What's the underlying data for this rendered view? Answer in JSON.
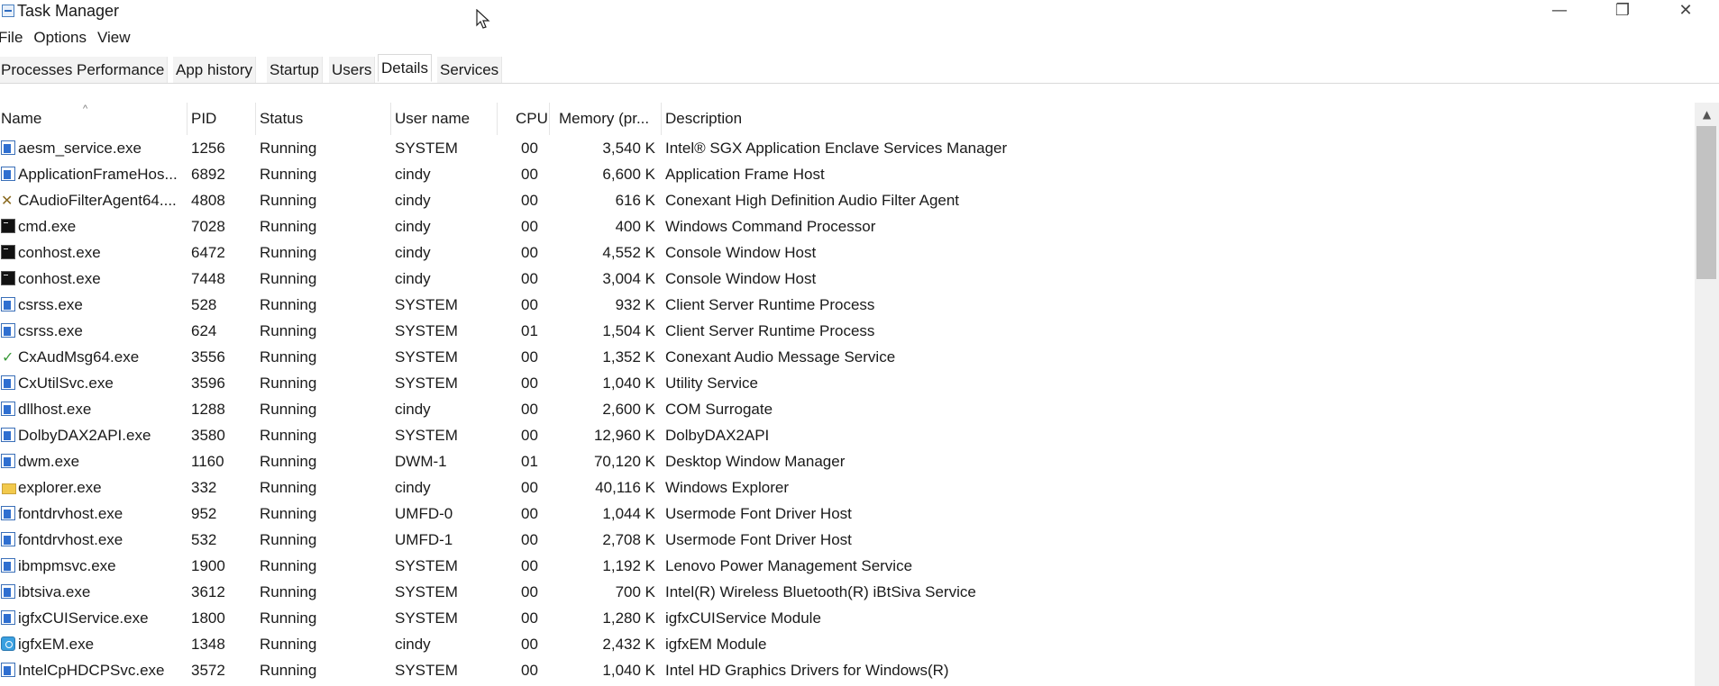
{
  "window": {
    "title": "Task Manager",
    "minimize_glyph": "—",
    "restore_glyph": "❐",
    "close_glyph": "✕"
  },
  "menu": [
    "File",
    "Options",
    "View"
  ],
  "tabs": [
    {
      "label": "Processes",
      "active": false
    },
    {
      "label": "Performance",
      "active": false
    },
    {
      "label": "App history",
      "active": false
    },
    {
      "label": "Startup",
      "active": false
    },
    {
      "label": "Users",
      "active": false
    },
    {
      "label": "Details",
      "active": true
    },
    {
      "label": "Services",
      "active": false
    }
  ],
  "table": {
    "columns": {
      "name": "Name",
      "pid": "PID",
      "status": "Status",
      "user": "User name",
      "cpu": "CPU",
      "memory": "Memory (pr...",
      "description": "Description"
    },
    "sort_glyph": "^",
    "rows": [
      {
        "icon": "app-icon",
        "name": "aesm_service.exe",
        "pid": "1256",
        "status": "Running",
        "user": "SYSTEM",
        "cpu": "00",
        "memory": "3,540 K",
        "description": "Intel® SGX Application Enclave Services Manager"
      },
      {
        "icon": "app-icon",
        "name": "ApplicationFrameHos...",
        "pid": "6892",
        "status": "Running",
        "user": "cindy",
        "cpu": "00",
        "memory": "6,600 K",
        "description": "Application Frame Host"
      },
      {
        "icon": "tools-icon",
        "name": "CAudioFilterAgent64....",
        "pid": "4808",
        "status": "Running",
        "user": "cindy",
        "cpu": "00",
        "memory": "616 K",
        "description": "Conexant High Definition Audio Filter Agent"
      },
      {
        "icon": "console-icon",
        "name": "cmd.exe",
        "pid": "7028",
        "status": "Running",
        "user": "cindy",
        "cpu": "00",
        "memory": "400 K",
        "description": "Windows Command Processor"
      },
      {
        "icon": "console-icon",
        "name": "conhost.exe",
        "pid": "6472",
        "status": "Running",
        "user": "cindy",
        "cpu": "00",
        "memory": "4,552 K",
        "description": "Console Window Host"
      },
      {
        "icon": "console-icon",
        "name": "conhost.exe",
        "pid": "7448",
        "status": "Running",
        "user": "cindy",
        "cpu": "00",
        "memory": "3,004 K",
        "description": "Console Window Host"
      },
      {
        "icon": "app-icon",
        "name": "csrss.exe",
        "pid": "528",
        "status": "Running",
        "user": "SYSTEM",
        "cpu": "00",
        "memory": "932 K",
        "description": "Client Server Runtime Process"
      },
      {
        "icon": "app-icon",
        "name": "csrss.exe",
        "pid": "624",
        "status": "Running",
        "user": "SYSTEM",
        "cpu": "01",
        "memory": "1,504 K",
        "description": "Client Server Runtime Process"
      },
      {
        "icon": "check-icon",
        "name": "CxAudMsg64.exe",
        "pid": "3556",
        "status": "Running",
        "user": "SYSTEM",
        "cpu": "00",
        "memory": "1,352 K",
        "description": "Conexant Audio Message Service"
      },
      {
        "icon": "app-icon",
        "name": "CxUtilSvc.exe",
        "pid": "3596",
        "status": "Running",
        "user": "SYSTEM",
        "cpu": "00",
        "memory": "1,040 K",
        "description": "Utility Service"
      },
      {
        "icon": "app-icon",
        "name": "dllhost.exe",
        "pid": "1288",
        "status": "Running",
        "user": "cindy",
        "cpu": "00",
        "memory": "2,600 K",
        "description": "COM Surrogate"
      },
      {
        "icon": "app-icon",
        "name": "DolbyDAX2API.exe",
        "pid": "3580",
        "status": "Running",
        "user": "SYSTEM",
        "cpu": "00",
        "memory": "12,960 K",
        "description": "DolbyDAX2API"
      },
      {
        "icon": "app-icon",
        "name": "dwm.exe",
        "pid": "1160",
        "status": "Running",
        "user": "DWM-1",
        "cpu": "01",
        "memory": "70,120 K",
        "description": "Desktop Window Manager"
      },
      {
        "icon": "folder-icon",
        "name": "explorer.exe",
        "pid": "332",
        "status": "Running",
        "user": "cindy",
        "cpu": "00",
        "memory": "40,116 K",
        "description": "Windows Explorer"
      },
      {
        "icon": "app-icon",
        "name": "fontdrvhost.exe",
        "pid": "952",
        "status": "Running",
        "user": "UMFD-0",
        "cpu": "00",
        "memory": "1,044 K",
        "description": "Usermode Font Driver Host"
      },
      {
        "icon": "app-icon",
        "name": "fontdrvhost.exe",
        "pid": "532",
        "status": "Running",
        "user": "UMFD-1",
        "cpu": "00",
        "memory": "2,708 K",
        "description": "Usermode Font Driver Host"
      },
      {
        "icon": "app-icon",
        "name": "ibmpmsvc.exe",
        "pid": "1900",
        "status": "Running",
        "user": "SYSTEM",
        "cpu": "00",
        "memory": "1,192 K",
        "description": "Lenovo Power Management Service"
      },
      {
        "icon": "app-icon",
        "name": "ibtsiva.exe",
        "pid": "3612",
        "status": "Running",
        "user": "SYSTEM",
        "cpu": "00",
        "memory": "700 K",
        "description": "Intel(R) Wireless Bluetooth(R) iBtSiva Service"
      },
      {
        "icon": "app-icon",
        "name": "igfxCUIService.exe",
        "pid": "1800",
        "status": "Running",
        "user": "SYSTEM",
        "cpu": "00",
        "memory": "1,280 K",
        "description": "igfxCUIService Module"
      },
      {
        "icon": "globe-icon",
        "name": "igfxEM.exe",
        "pid": "1348",
        "status": "Running",
        "user": "cindy",
        "cpu": "00",
        "memory": "2,432 K",
        "description": "igfxEM Module"
      },
      {
        "icon": "app-icon",
        "name": "IntelCpHDCPSvc.exe",
        "pid": "3572",
        "status": "Running",
        "user": "SYSTEM",
        "cpu": "00",
        "memory": "1,040 K",
        "description": "Intel HD Graphics Drivers for Windows(R)"
      }
    ]
  },
  "scrollbar": {
    "up_glyph": "▲"
  }
}
